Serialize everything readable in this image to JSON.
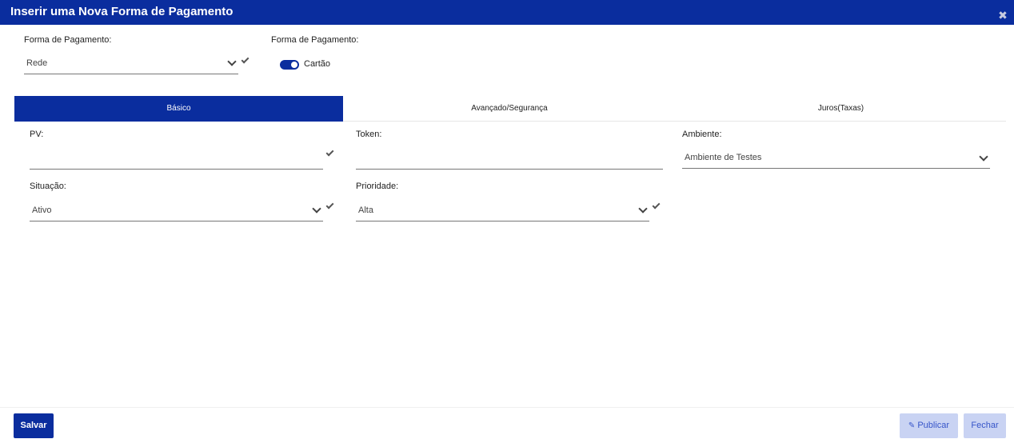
{
  "window": {
    "title": "Inserir uma Nova Forma de Pagamento",
    "close_icon": "close-icon"
  },
  "top": {
    "forma_label": "Forma de Pagamento:",
    "forma_value": "Rede",
    "forma2_label": "Forma de Pagamento:",
    "toggle_label": "Cartão",
    "toggle_on": true
  },
  "tabs": [
    {
      "label": "Básico",
      "active": true
    },
    {
      "label": "Avançado/Segurança",
      "active": false
    },
    {
      "label": "Juros(Taxas)",
      "active": false
    }
  ],
  "form": {
    "pv_label": "PV:",
    "pv_value": "",
    "token_label": "Token:",
    "token_value": "",
    "ambiente_label": "Ambiente:",
    "ambiente_value": "Ambiente de Testes",
    "situacao_label": "Situação:",
    "situacao_value": "Ativo",
    "prioridade_label": "Prioridade:",
    "prioridade_value": "Alta"
  },
  "footer": {
    "save_label": "Salvar",
    "publish_label": "Publicar",
    "close_label": "Fechar"
  },
  "colors": {
    "primary": "#0a2d9e",
    "light_button": "#c9d3f3",
    "light_button_text": "#3655c9"
  }
}
